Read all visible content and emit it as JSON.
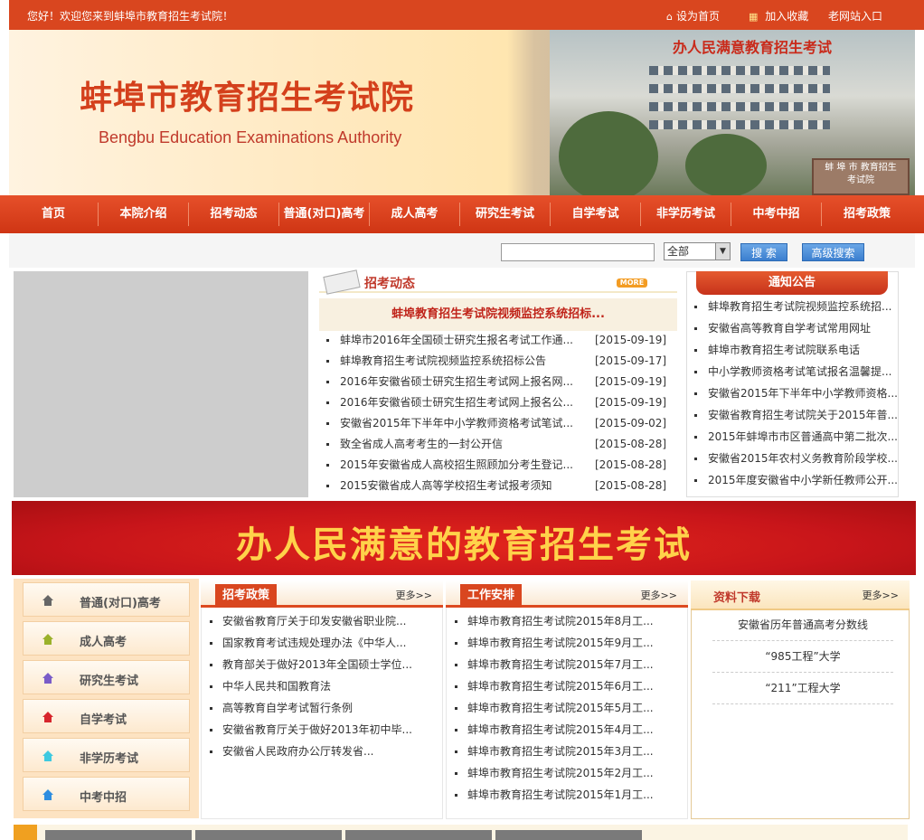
{
  "topbar": {
    "welcome": "您好！欢迎您来到蚌埠市教育招生考试院！",
    "set_home": "设为首页",
    "add_favorite": "加入收藏",
    "old_site": "老网站入口"
  },
  "header": {
    "title_cn": "蚌埠市教育招生考试院",
    "title_en": "Bengbu Education Examinations Authority",
    "photo_slogan": "办人民满意教育招生考试",
    "gate_sign": "蚌 埠 市 教育招生考试院"
  },
  "nav": [
    "首页",
    "本院介绍",
    "招考动态",
    "普通(对口)高考",
    "成人高考",
    "研究生考试",
    "自学考试",
    "非学历考试",
    "中考中招",
    "招考政策"
  ],
  "search": {
    "input_value": "",
    "select_value": "全部",
    "search_button": "搜 索",
    "advanced_button": "高级搜索"
  },
  "news": {
    "title": "招考动态",
    "more": "MORE",
    "feature": "蚌埠教育招生考试院视频监控系统招标...",
    "items": [
      {
        "title": "蚌埠市2016年全国硕士研究生报名考试工作通...",
        "date": "[2015-09-19]"
      },
      {
        "title": "蚌埠教育招生考试院视频监控系统招标公告",
        "date": "[2015-09-17]"
      },
      {
        "title": "2016年安徽省硕士研究生招生考试网上报名网...",
        "date": "[2015-09-19]"
      },
      {
        "title": "2016年安徽省硕士研究生招生考试网上报名公...",
        "date": "[2015-09-19]"
      },
      {
        "title": "安徽省2015年下半年中小学教师资格考试笔试...",
        "date": "[2015-09-02]"
      },
      {
        "title": "致全省成人高考考生的一封公开信",
        "date": "[2015-08-28]"
      },
      {
        "title": "2015年安徽省成人高校招生照顾加分考生登记...",
        "date": "[2015-08-28]"
      },
      {
        "title": "2015安徽省成人高等学校招生考试报考须知",
        "date": "[2015-08-28]"
      }
    ]
  },
  "notice": {
    "title": "通知公告",
    "items": [
      "蚌埠教育招生考试院视频监控系统招...",
      "安徽省高等教育自学考试常用网址",
      "蚌埠市教育招生考试院联系电话",
      "中小学教师资格考试笔试报名温馨提...",
      "安徽省2015年下半年中小学教师资格...",
      "安徽省教育招生考试院关于2015年普...",
      "2015年蚌埠市市区普通高中第二批次...",
      "安徽省2015年农村义务教育阶段学校...",
      "2015年度安徽省中小学新任教师公开..."
    ]
  },
  "banner": {
    "text": "办人民满意的教育招生考试"
  },
  "left_menu": [
    {
      "label": "普通(对口)高考",
      "icon": "house-icon",
      "color": "#666666"
    },
    {
      "label": "成人高考",
      "icon": "house-icon",
      "color": "#9bb12a"
    },
    {
      "label": "研究生考试",
      "icon": "house-icon",
      "color": "#7a5cc8"
    },
    {
      "label": "自学考试",
      "icon": "house-icon",
      "color": "#d7262c"
    },
    {
      "label": "非学历考试",
      "icon": "house-icon",
      "color": "#3ec9e0"
    },
    {
      "label": "中考中招",
      "icon": "house-icon",
      "color": "#2e8de0"
    }
  ],
  "policy": {
    "title": "招考政策",
    "more": "更多>>",
    "items": [
      "安徽省教育厅关于印发安徽省职业院...",
      "国家教育考试违规处理办法《中华人...",
      "教育部关于做好2013年全国硕士学位...",
      "中华人民共和国教育法",
      "高等教育自学考试暂行条例",
      "安徽省教育厅关于做好2013年初中毕...",
      "安徽省人民政府办公厅转发省..."
    ]
  },
  "work": {
    "title": "工作安排",
    "more": "更多>>",
    "items": [
      "蚌埠市教育招生考试院2015年8月工...",
      "蚌埠市教育招生考试院2015年9月工...",
      "蚌埠市教育招生考试院2015年7月工...",
      "蚌埠市教育招生考试院2015年6月工...",
      "蚌埠市教育招生考试院2015年5月工...",
      "蚌埠市教育招生考试院2015年4月工...",
      "蚌埠市教育招生考试院2015年3月工...",
      "蚌埠市教育招生考试院2015年2月工...",
      "蚌埠市教育招生考试院2015年1月工..."
    ]
  },
  "downloads": {
    "title": "资料下载",
    "more": "更多>>",
    "items": [
      "安徽省历年普通高考分数线",
      "“985工程”大学",
      "“211”工程大学"
    ]
  },
  "colors": {
    "brand_red": "#d9461f",
    "nav_red": "#cf3514",
    "title_red": "#d4401c",
    "banner_gold": "#ffd24a"
  }
}
